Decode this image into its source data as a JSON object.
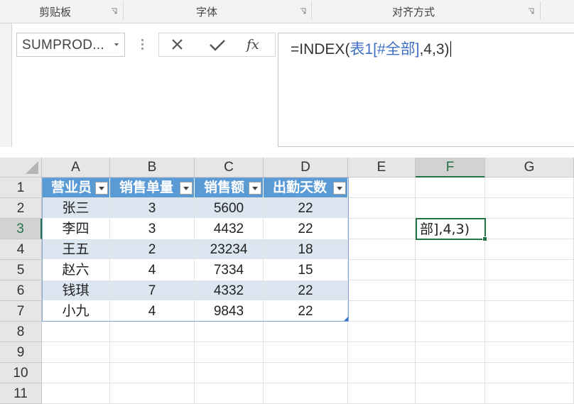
{
  "ribbon": {
    "groups": [
      {
        "label": "剪贴板"
      },
      {
        "label": "字体"
      },
      {
        "label": "对齐方式"
      }
    ]
  },
  "formula_bar": {
    "name_box": "SUMPROD...",
    "cancel_icon": "close-icon",
    "enter_icon": "check-icon",
    "fx_icon": "function-icon",
    "fx_label": "fx",
    "formula_prefix": "=INDEX(",
    "formula_ref": "表1[#全部]",
    "formula_suffix": ",4,3)"
  },
  "grid": {
    "columns": [
      "A",
      "B",
      "C",
      "D",
      "E",
      "F",
      "G"
    ],
    "rows": [
      "1",
      "2",
      "3",
      "4",
      "5",
      "6",
      "7",
      "8",
      "9",
      "10",
      "11"
    ],
    "active_column": "F",
    "active_row": "3",
    "table": {
      "headers": [
        "营业员",
        "销售单量",
        "销售额",
        "出勤天数"
      ],
      "rows": [
        [
          "张三",
          "3",
          "5600",
          "22"
        ],
        [
          "李四",
          "3",
          "4432",
          "22"
        ],
        [
          "王五",
          "2",
          "23234",
          "18"
        ],
        [
          "赵六",
          "4",
          "7334",
          "15"
        ],
        [
          "钱琪",
          "7",
          "4332",
          "22"
        ],
        [
          "小九",
          "4",
          "9843",
          "22"
        ]
      ]
    },
    "selected_cell": {
      "ref": "F3",
      "text": "部],4,3)"
    }
  },
  "colors": {
    "header_fill": "#5b9bd5",
    "band_fill": "#dce6f1",
    "selection": "#217346",
    "formula_ref": "#3f6fc4"
  }
}
